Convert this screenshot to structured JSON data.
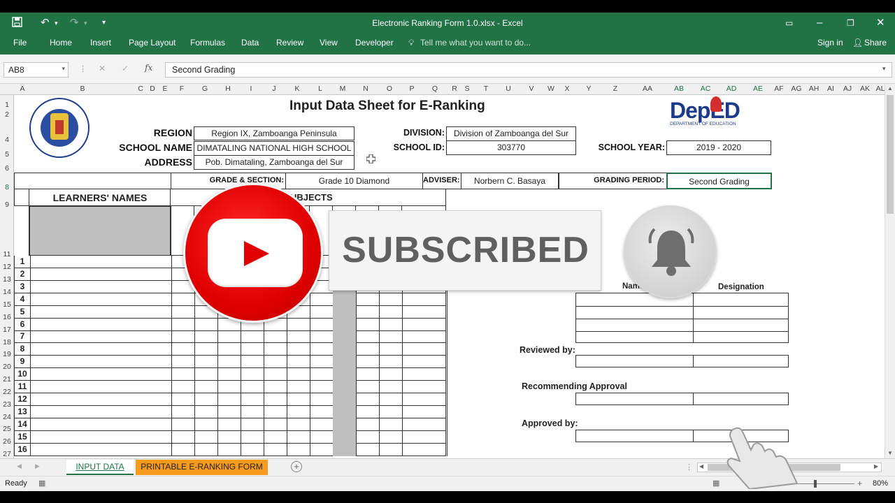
{
  "window": {
    "title": "Electronic Ranking Form 1.0.xlsx - Excel",
    "sign_in": "Sign in",
    "share": "Share"
  },
  "ribbon": {
    "tabs": [
      "File",
      "Home",
      "Insert",
      "Page Layout",
      "Formulas",
      "Data",
      "Review",
      "View",
      "Developer"
    ],
    "tell_me": "Tell me what you want to do..."
  },
  "formula_bar": {
    "name_box": "AB8",
    "fx": "fx",
    "content": "Second Grading"
  },
  "columns": [
    "A",
    "B",
    "C",
    "D",
    "E",
    "F",
    "G",
    "H",
    "I",
    "J",
    "K",
    "L",
    "M",
    "N",
    "O",
    "P",
    "Q",
    "R",
    "S",
    "T",
    "U",
    "V",
    "W",
    "X",
    "Y",
    "Z",
    "AA",
    "AB",
    "AC",
    "AD",
    "AE",
    "AF",
    "AG",
    "AH",
    "AI",
    "AJ",
    "AK",
    "AL"
  ],
  "rows": [
    "1",
    "2",
    "4",
    "5",
    "6",
    "8",
    "9",
    "11",
    "12",
    "13",
    "14",
    "15",
    "16",
    "17",
    "18",
    "19",
    "20",
    "21",
    "22",
    "23",
    "24",
    "25",
    "26",
    "27"
  ],
  "sheet": {
    "title": "Input Data Sheet for E-Ranking",
    "region_label": "REGION",
    "region": "Region IX, Zamboanga Peninsula",
    "school_name_label": "SCHOOL NAME",
    "school_name": "DIMATALING NATIONAL HIGH SCHOOL",
    "address_label": "ADDRESS",
    "address": "Pob. Dimataling, Zamboanga del Sur",
    "division_label": "DIVISION:",
    "division": "Division of Zamboanga del Sur",
    "school_id_label": "SCHOOL ID:",
    "school_id": "303770",
    "school_year_label": "SCHOOL YEAR:",
    "school_year": "2019 - 2020",
    "grade_section_label": "GRADE & SECTION:",
    "grade_section": "Grade 10 Diamond",
    "adviser_label": "ADVISER:",
    "adviser": "Norbern C. Basaya",
    "grading_period_label": "GRADING PERIOD:",
    "grading_period": "Second Grading",
    "learners_header": "LEARNERS' NAMES",
    "subjects_header": "SUBJECTS",
    "learner_numbers": [
      "1",
      "2",
      "3",
      "4",
      "5",
      "6",
      "7",
      "8",
      "9",
      "10",
      "11",
      "12",
      "13",
      "14",
      "15",
      "16"
    ],
    "name_header": "Name",
    "designation_header": "Designation",
    "reviewed_by": "Reviewed by:",
    "recommending": "Recommending Approval",
    "approved_by": "Approved by:",
    "deped_logo": "DepED",
    "deped_sub": "DEPARTMENT OF EDUCATION",
    "seal_text": "KAGAWARAN NG EDUKASYON"
  },
  "sheet_tabs": [
    "INPUT DATA",
    "PRINTABLE E-RANKING FORM"
  ],
  "status": {
    "ready": "Ready",
    "zoom": "80%"
  },
  "overlay": {
    "subscribed": "SUBSCRIBED"
  },
  "colors": {
    "excel_green": "#217346",
    "tab_orange": "#f79b1e",
    "youtube_red": "#e00000"
  }
}
